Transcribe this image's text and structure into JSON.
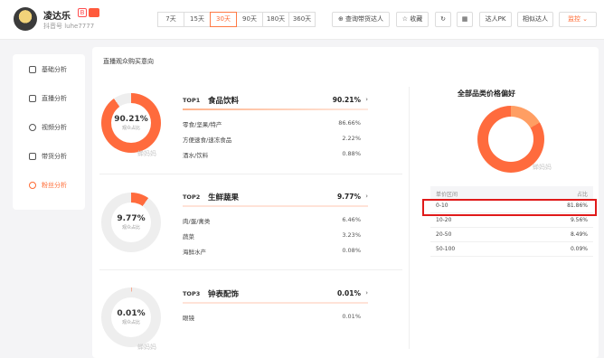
{
  "header": {
    "name": "凌达乐",
    "badge_text": "B",
    "uid": "抖音号 luhe7777",
    "days": [
      "7天",
      "15天",
      "30天",
      "90天",
      "180天",
      "360天"
    ],
    "active_day": "30天",
    "buttons": {
      "compare": "查询带货达人",
      "collect": "收藏",
      "pk": "达人PK",
      "similar": "相似达人",
      "monitor": "监控"
    }
  },
  "sidebar": {
    "items": [
      {
        "label": "基础分析",
        "icon": "chart-icon"
      },
      {
        "label": "直播分析",
        "icon": "tv-icon"
      },
      {
        "label": "视频分析",
        "icon": "play-icon"
      },
      {
        "label": "带货分析",
        "icon": "bag-icon"
      },
      {
        "label": "粉丝分析",
        "icon": "user-icon"
      }
    ],
    "active": "粉丝分析"
  },
  "main": {
    "section_title": "直播观众购买意向",
    "watermark": "蝉妈妈",
    "ring_sub": "观众占比",
    "categories": [
      {
        "rank": "TOP1",
        "name": "食品饮料",
        "pct": "90.21%",
        "ring_value": 90.21,
        "subs": [
          {
            "name": "零食/坚果/特产",
            "pct": "86.66%"
          },
          {
            "name": "方便速食/速冻食品",
            "pct": "2.22%"
          },
          {
            "name": "酒水/饮料",
            "pct": "0.88%"
          }
        ]
      },
      {
        "rank": "TOP2",
        "name": "生鲜蔬果",
        "pct": "9.77%",
        "ring_value": 9.77,
        "subs": [
          {
            "name": "肉/蛋/禽类",
            "pct": "6.46%"
          },
          {
            "name": "蔬菜",
            "pct": "3.23%"
          },
          {
            "name": "海鲜水产",
            "pct": "0.08%"
          }
        ]
      },
      {
        "rank": "TOP3",
        "name": "钟表配饰",
        "pct": "0.01%",
        "ring_value": 0.01,
        "subs": [
          {
            "name": "眼镜",
            "pct": "0.01%"
          }
        ]
      }
    ]
  },
  "price_pref": {
    "title": "全部品类价格偏好",
    "col_range": "单价区间",
    "col_pct": "占比",
    "ring_share": 81.86,
    "rows": [
      {
        "range": "0-10",
        "pct": "81.86%"
      },
      {
        "range": "10-20",
        "pct": "9.56%"
      },
      {
        "range": "20-50",
        "pct": "8.49%"
      },
      {
        "range": "50-100",
        "pct": "0.09%"
      }
    ]
  },
  "colors": {
    "accent": "#ff6a33",
    "ring": "#ff6b3d",
    "ring_track": "#eeeeee",
    "highlight": "#e01a1a"
  }
}
